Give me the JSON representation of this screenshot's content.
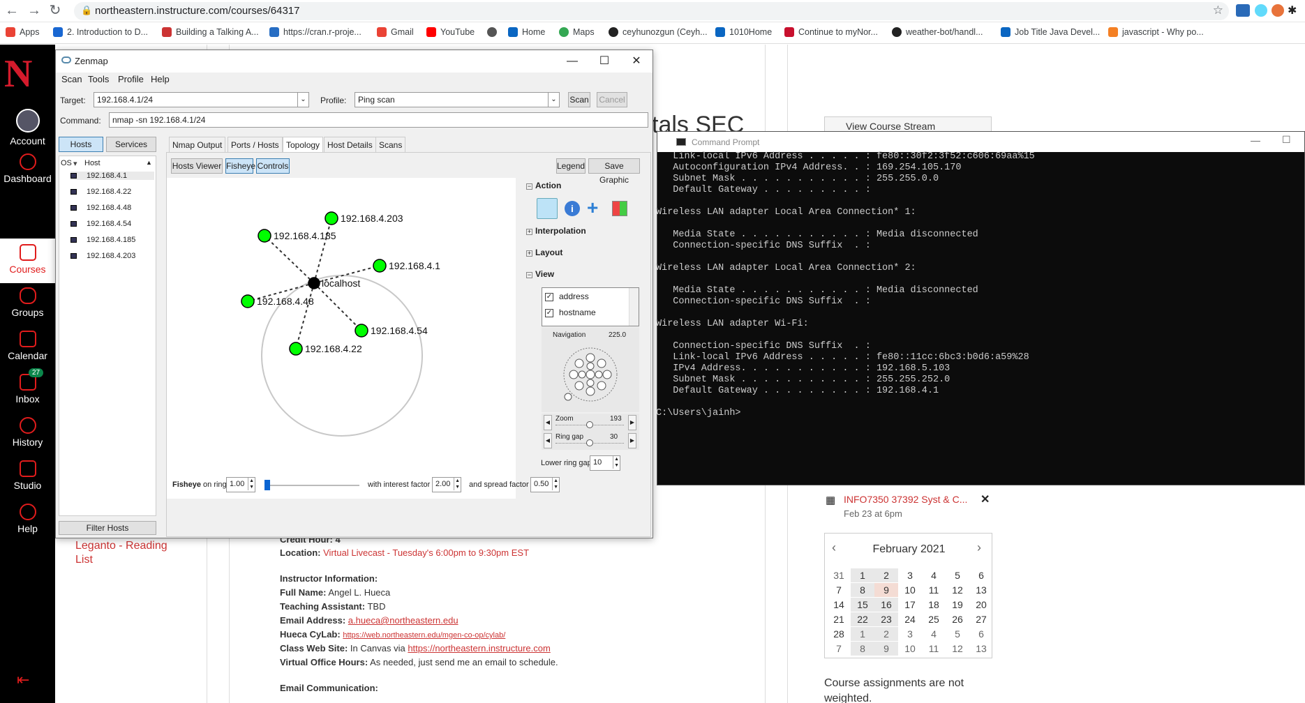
{
  "browser": {
    "url": "northeastern.instructure.com/courses/64317",
    "bookmarks": [
      "Apps",
      "2. Introduction to D...",
      "Building a Talking A...",
      "https://cran.r-proje...",
      "Gmail",
      "YouTube",
      "Home",
      "Maps",
      "ceyhunozgun (Ceyh...",
      "1010Home",
      "Continue to myNor...",
      "weather-bot/handl...",
      "Job Title Java Devel...",
      "javascript - Why po..."
    ]
  },
  "canvas_nav": {
    "items": [
      {
        "label": "Account"
      },
      {
        "label": "Dashboard"
      },
      {
        "label": "Courses"
      },
      {
        "label": "Groups"
      },
      {
        "label": "Calendar"
      },
      {
        "label": "Inbox",
        "badge": "27"
      },
      {
        "label": "History"
      },
      {
        "label": "Studio"
      },
      {
        "label": "Help"
      }
    ]
  },
  "page": {
    "heading_fragment": "tals SEC",
    "view_stream": "View Course Stream",
    "leganto": "Leganto - Reading List",
    "credit_hour": "Credit Hour: 4",
    "location_label": "Location:",
    "location_value": "Virtual Livecast - Tuesday's 6:00pm to 9:30pm EST",
    "instructor_heading": "Instructor Information:",
    "full_name_label": "Full Name:",
    "full_name": "Angel L. Hueca",
    "ta_label": "Teaching Assistant:",
    "ta": "TBD",
    "email_label": "Email Address:",
    "email": "a.hueca@northeastern.edu",
    "cylab_label": "Hueca CyLab:",
    "cylab": "https://web.northeastern.edu/mgen-co-op/cylab/",
    "site_label": "Class Web Site:",
    "site_prefix": "In Canvas via",
    "site": "https://northeastern.instructure.com",
    "office_label": "Virtual Office Hours:",
    "office": "As needed, just send me an email to schedule.",
    "email_comm_heading": "Email Communication:",
    "todo_title": "INFO7350 37392 Syst & C...",
    "todo_date": "Feb 23 at 6pm",
    "assign_note": "Course assignments are not weighted."
  },
  "calendar": {
    "month": "February 2021",
    "rows": [
      [
        "31",
        "1",
        "2",
        "3",
        "4",
        "5",
        "6"
      ],
      [
        "7",
        "8",
        "9",
        "10",
        "11",
        "12",
        "13"
      ],
      [
        "14",
        "15",
        "16",
        "17",
        "18",
        "19",
        "20"
      ],
      [
        "21",
        "22",
        "23",
        "24",
        "25",
        "26",
        "27"
      ],
      [
        "28",
        "1",
        "2",
        "3",
        "4",
        "5",
        "6"
      ],
      [
        "7",
        "8",
        "9",
        "10",
        "11",
        "12",
        "13"
      ]
    ]
  },
  "zenmap": {
    "title": "Zenmap",
    "menus": [
      "Scan",
      "Tools",
      "Profile",
      "Help"
    ],
    "target_label": "Target:",
    "target": "192.168.4.1/24",
    "profile_label": "Profile:",
    "profile": "Ping scan",
    "scan": "Scan",
    "cancel": "Cancel",
    "command_label": "Command:",
    "command": "nmap -sn 192.168.4.1/24",
    "hosts_btn": "Hosts",
    "services_btn": "Services",
    "os_col": "OS",
    "host_col": "Host",
    "hosts": [
      "192.168.4.1",
      "192.168.4.22",
      "192.168.4.48",
      "192.168.4.54",
      "192.168.4.185",
      "192.168.4.203"
    ],
    "filter": "Filter Hosts",
    "tabs": [
      "Nmap Output",
      "Ports / Hosts",
      "Topology",
      "Host Details",
      "Scans"
    ],
    "topo_btns": [
      "Hosts Viewer",
      "Fisheye",
      "Controls"
    ],
    "legend": "Legend",
    "save_graphic": "Save Graphic",
    "nodes": [
      "192.168.4.203",
      "192.168.4.185",
      "192.168.4.1",
      "localhost",
      "192.168.4.48",
      "192.168.4.54",
      "192.168.4.22"
    ],
    "action": "Action",
    "interpolation": "Interpolation",
    "layout": "Layout",
    "view": "View",
    "view_opts": [
      "address",
      "hostname"
    ],
    "navigation": "Navigation",
    "nav_value": "225.0",
    "zoom": "Zoom",
    "zoom_value": "193",
    "ringgap": "Ring gap",
    "ringgap_value": "30",
    "lower_ring_gap": "Lower ring gap",
    "lower_ring_gap_value": "10",
    "fisheye_label": "Fisheye",
    "on_ring": "on ring",
    "ring_value": "1.00",
    "interest_label": "with interest factor",
    "interest_value": "2.00",
    "spread_label": "and spread factor",
    "spread_value": "0.50"
  },
  "cmd": {
    "title": "Command Prompt",
    "lines": [
      "   Link-local IPv6 Address . . . . . : fe80::30f2:3f52:c606:69aa%15",
      "   Autoconfiguration IPv4 Address. . : 169.254.105.170",
      "   Subnet Mask . . . . . . . . . . . : 255.255.0.0",
      "   Default Gateway . . . . . . . . . :",
      "",
      "Wireless LAN adapter Local Area Connection* 1:",
      "",
      "   Media State . . . . . . . . . . . : Media disconnected",
      "   Connection-specific DNS Suffix  . :",
      "",
      "Wireless LAN adapter Local Area Connection* 2:",
      "",
      "   Media State . . . . . . . . . . . : Media disconnected",
      "   Connection-specific DNS Suffix  . :",
      "",
      "Wireless LAN adapter Wi-Fi:",
      "",
      "   Connection-specific DNS Suffix  . :",
      "   Link-local IPv6 Address . . . . . : fe80::11cc:6bc3:b0d6:a59%28",
      "   IPv4 Address. . . . . . . . . . . : 192.168.5.103",
      "   Subnet Mask . . . . . . . . . . . : 255.255.252.0",
      "   Default Gateway . . . . . . . . . : 192.168.4.1",
      "",
      "C:\\Users\\jainh>"
    ]
  }
}
